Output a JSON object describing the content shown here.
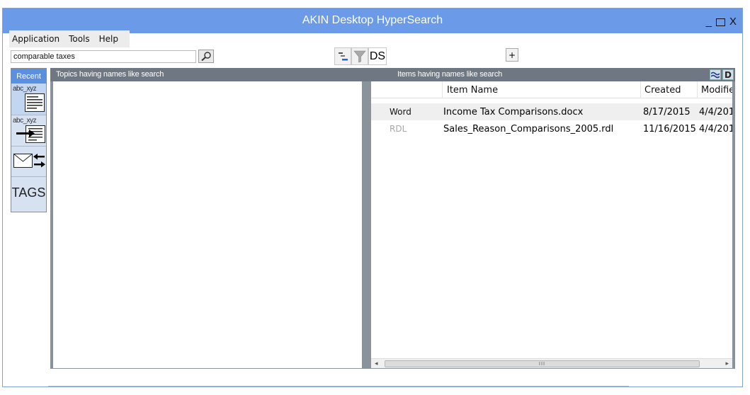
{
  "window": {
    "title": "AKIN Desktop HyperSearch",
    "minimize": "_",
    "close": "X"
  },
  "menu": {
    "items": [
      "Application",
      "Tools",
      "Help"
    ]
  },
  "search": {
    "value": "comparable taxes"
  },
  "toolbar": {
    "ds_label": "DS",
    "plus_label": "+"
  },
  "sidebar": {
    "recent_label": "Recent",
    "item1_caption": "abc_xyz",
    "item2_caption": "abc_xyz",
    "tags_label": "TAGS"
  },
  "panels": {
    "topics_header": "Topics having names like search",
    "items_header": "Items having names like search",
    "icon_d": "D"
  },
  "items_table": {
    "columns": [
      "Item Name",
      "Created",
      "Modifie"
    ],
    "rows": [
      {
        "type": "Word",
        "name": "Income Tax Comparisons.docx",
        "created": "8/17/2015",
        "modified": "4/4/201"
      },
      {
        "type": "RDL",
        "name": "Sales_Reason_Comparisons_2005.rdl",
        "created": "11/16/2015",
        "modified": "4/4/201"
      }
    ]
  },
  "scrollbar": {
    "left": "◂",
    "thumb_grip": "III",
    "right": "▸"
  },
  "colors": {
    "title_bar": "#6a9ae8",
    "recent_tab": "#5b8fe0",
    "panel_header": "#6f7782"
  }
}
